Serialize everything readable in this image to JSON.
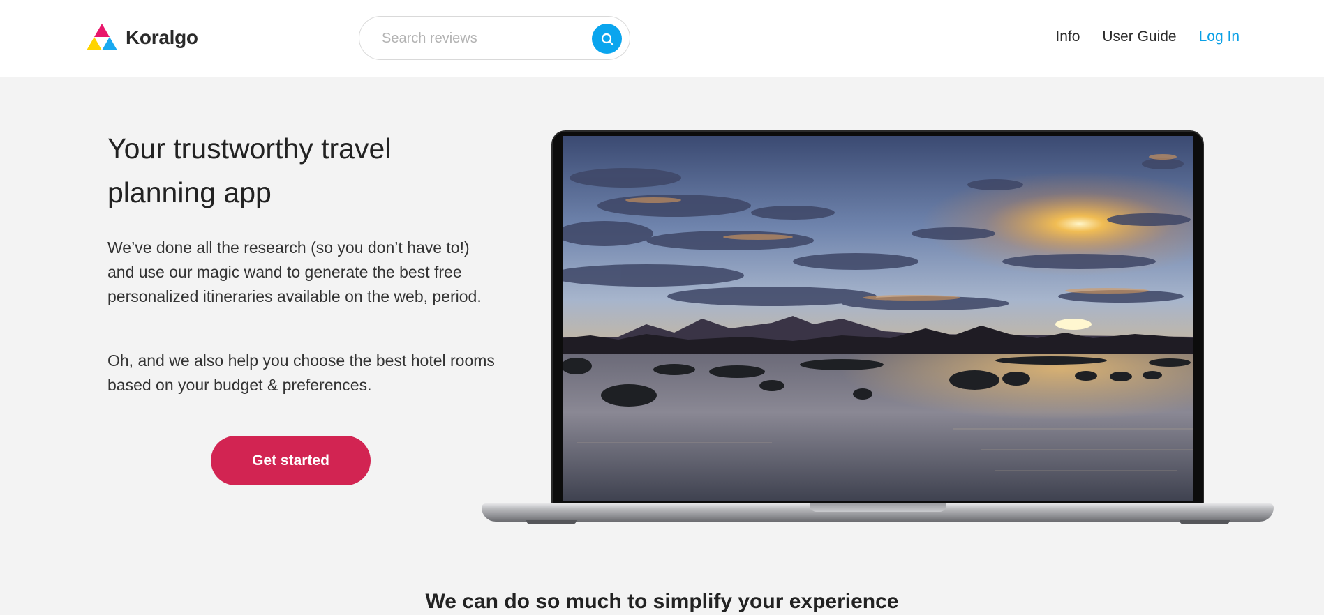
{
  "header": {
    "brand": "Koralgo",
    "search": {
      "placeholder": "Search reviews"
    },
    "nav": [
      {
        "label": "Info"
      },
      {
        "label": "User Guide"
      },
      {
        "label": "Log In"
      }
    ]
  },
  "colors": {
    "brand_pink": "#e8176b",
    "brand_yellow": "#ffd400",
    "brand_blue": "#19a9f0",
    "accent_blue": "#0aa5ee",
    "cta_red": "#d22452",
    "login_blue": "#0aa0e6"
  },
  "hero": {
    "title": "Your trustworthy travel planning app",
    "paragraph1": "We’ve done all the research (so you don’t have to!) and use our magic wand to generate the best free personalized itineraries available on the web, period.",
    "paragraph2": "Oh, and we also help you choose the best hotel rooms based on your budget & preferences.",
    "cta": "Get started"
  },
  "section": {
    "title": "We can do so much to simplify your experience"
  },
  "icons": {
    "logo": "triangle-logo-icon",
    "search": "search-icon",
    "image": "sunset-lake-photo"
  }
}
